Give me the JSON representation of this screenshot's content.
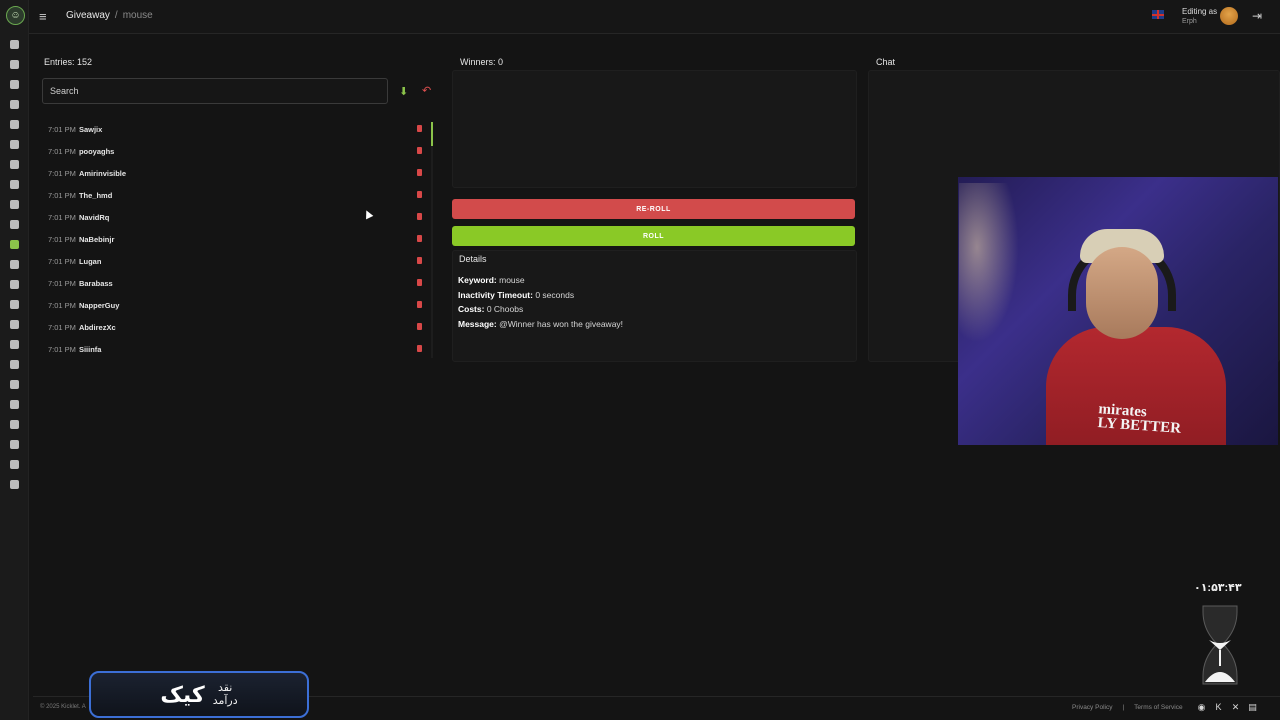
{
  "topbar": {
    "breadcrumb": [
      "Giveaway",
      "mouse"
    ],
    "breadcrumb_separator": "/",
    "editing_label": "Editing as",
    "editing_user": "Erph"
  },
  "sidebar": {
    "logo_icon": "kicklet-logo",
    "items": [
      {
        "icon": "dashboard-icon"
      },
      {
        "icon": "document-icon"
      },
      {
        "icon": "tools-icon"
      },
      {
        "icon": "hammer-icon"
      },
      {
        "icon": "chat-icon"
      },
      {
        "icon": "clock-icon"
      },
      {
        "icon": "shield-icon"
      },
      {
        "icon": "warning-icon"
      },
      {
        "icon": "music-icon"
      },
      {
        "icon": "star-icon"
      },
      {
        "icon": "gift-icon",
        "active": true
      },
      {
        "icon": "cart-icon"
      },
      {
        "icon": "link-icon"
      },
      {
        "icon": "chart-icon"
      },
      {
        "icon": "video-icon"
      },
      {
        "icon": "box-icon"
      },
      {
        "icon": "emoji-icon"
      },
      {
        "icon": "clapper-icon"
      },
      {
        "icon": "message-icon"
      },
      {
        "icon": "monitor-icon"
      },
      {
        "icon": "search-icon"
      },
      {
        "icon": "gamepad-icon"
      },
      {
        "icon": "wallet-icon"
      }
    ]
  },
  "entries": {
    "title": "Entries: 152",
    "search_placeholder": "Search",
    "items": [
      {
        "time": "7:01 PM",
        "name": "Sawjix"
      },
      {
        "time": "7:01 PM",
        "name": "pooyaghs"
      },
      {
        "time": "7:01 PM",
        "name": "Amirinvisible"
      },
      {
        "time": "7:01 PM",
        "name": "The_hmd"
      },
      {
        "time": "7:01 PM",
        "name": "NavidRq"
      },
      {
        "time": "7:01 PM",
        "name": "NaBebinjr"
      },
      {
        "time": "7:01 PM",
        "name": "Lugan"
      },
      {
        "time": "7:01 PM",
        "name": "Barabass"
      },
      {
        "time": "7:01 PM",
        "name": "NapperGuy"
      },
      {
        "time": "7:01 PM",
        "name": "AbdirezXc"
      },
      {
        "time": "7:01 PM",
        "name": "Siiinfa"
      }
    ]
  },
  "winners": {
    "title": "Winners: 0",
    "reroll_label": "RE-ROLL",
    "roll_label": "ROLL"
  },
  "details": {
    "title": "Details",
    "keyword_label": "Keyword:",
    "keyword": "mouse",
    "inactivity_label": "Inactivity Timeout:",
    "inactivity": "0 seconds",
    "costs_label": "Costs:",
    "costs": "0 Choobs",
    "message_label": "Message:",
    "message": "@Winner has won the giveaway!"
  },
  "chat": {
    "title": "Chat"
  },
  "webcam": {
    "shirt_text": "mirates\nLY BETTER"
  },
  "timer": {
    "value": "۰۱:۵۳:۴۳"
  },
  "banner": {
    "big": "کیک",
    "line1": "نقد",
    "line2": "درآمد"
  },
  "footer": {
    "copyright": "© 2025 Kicklet. A",
    "privacy": "Privacy Policy",
    "divider": "|",
    "terms": "Terms of Service"
  },
  "colors": {
    "accent_green": "#8ac926",
    "danger_red": "#d24b4b",
    "background": "#141414"
  }
}
